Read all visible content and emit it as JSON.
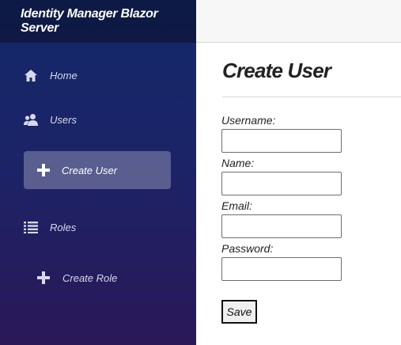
{
  "app": {
    "brand": "Identity Manager Blazor Server"
  },
  "nav": {
    "home": {
      "label": "Home",
      "icon": "home-icon"
    },
    "users": {
      "label": "Users",
      "icon": "users-icon"
    },
    "create_user": {
      "label": "Create User",
      "icon": "plus-icon",
      "active": true
    },
    "roles": {
      "label": "Roles",
      "icon": "list-icon"
    },
    "create_role": {
      "label": "Create Role",
      "icon": "plus-icon"
    }
  },
  "page": {
    "title": "Create User"
  },
  "form": {
    "username_label": "Username:",
    "username_value": "",
    "name_label": "Name:",
    "name_value": "",
    "email_label": "Email:",
    "email_value": "",
    "password_label": "Password:",
    "password_value": "",
    "save_label": "Save"
  }
}
